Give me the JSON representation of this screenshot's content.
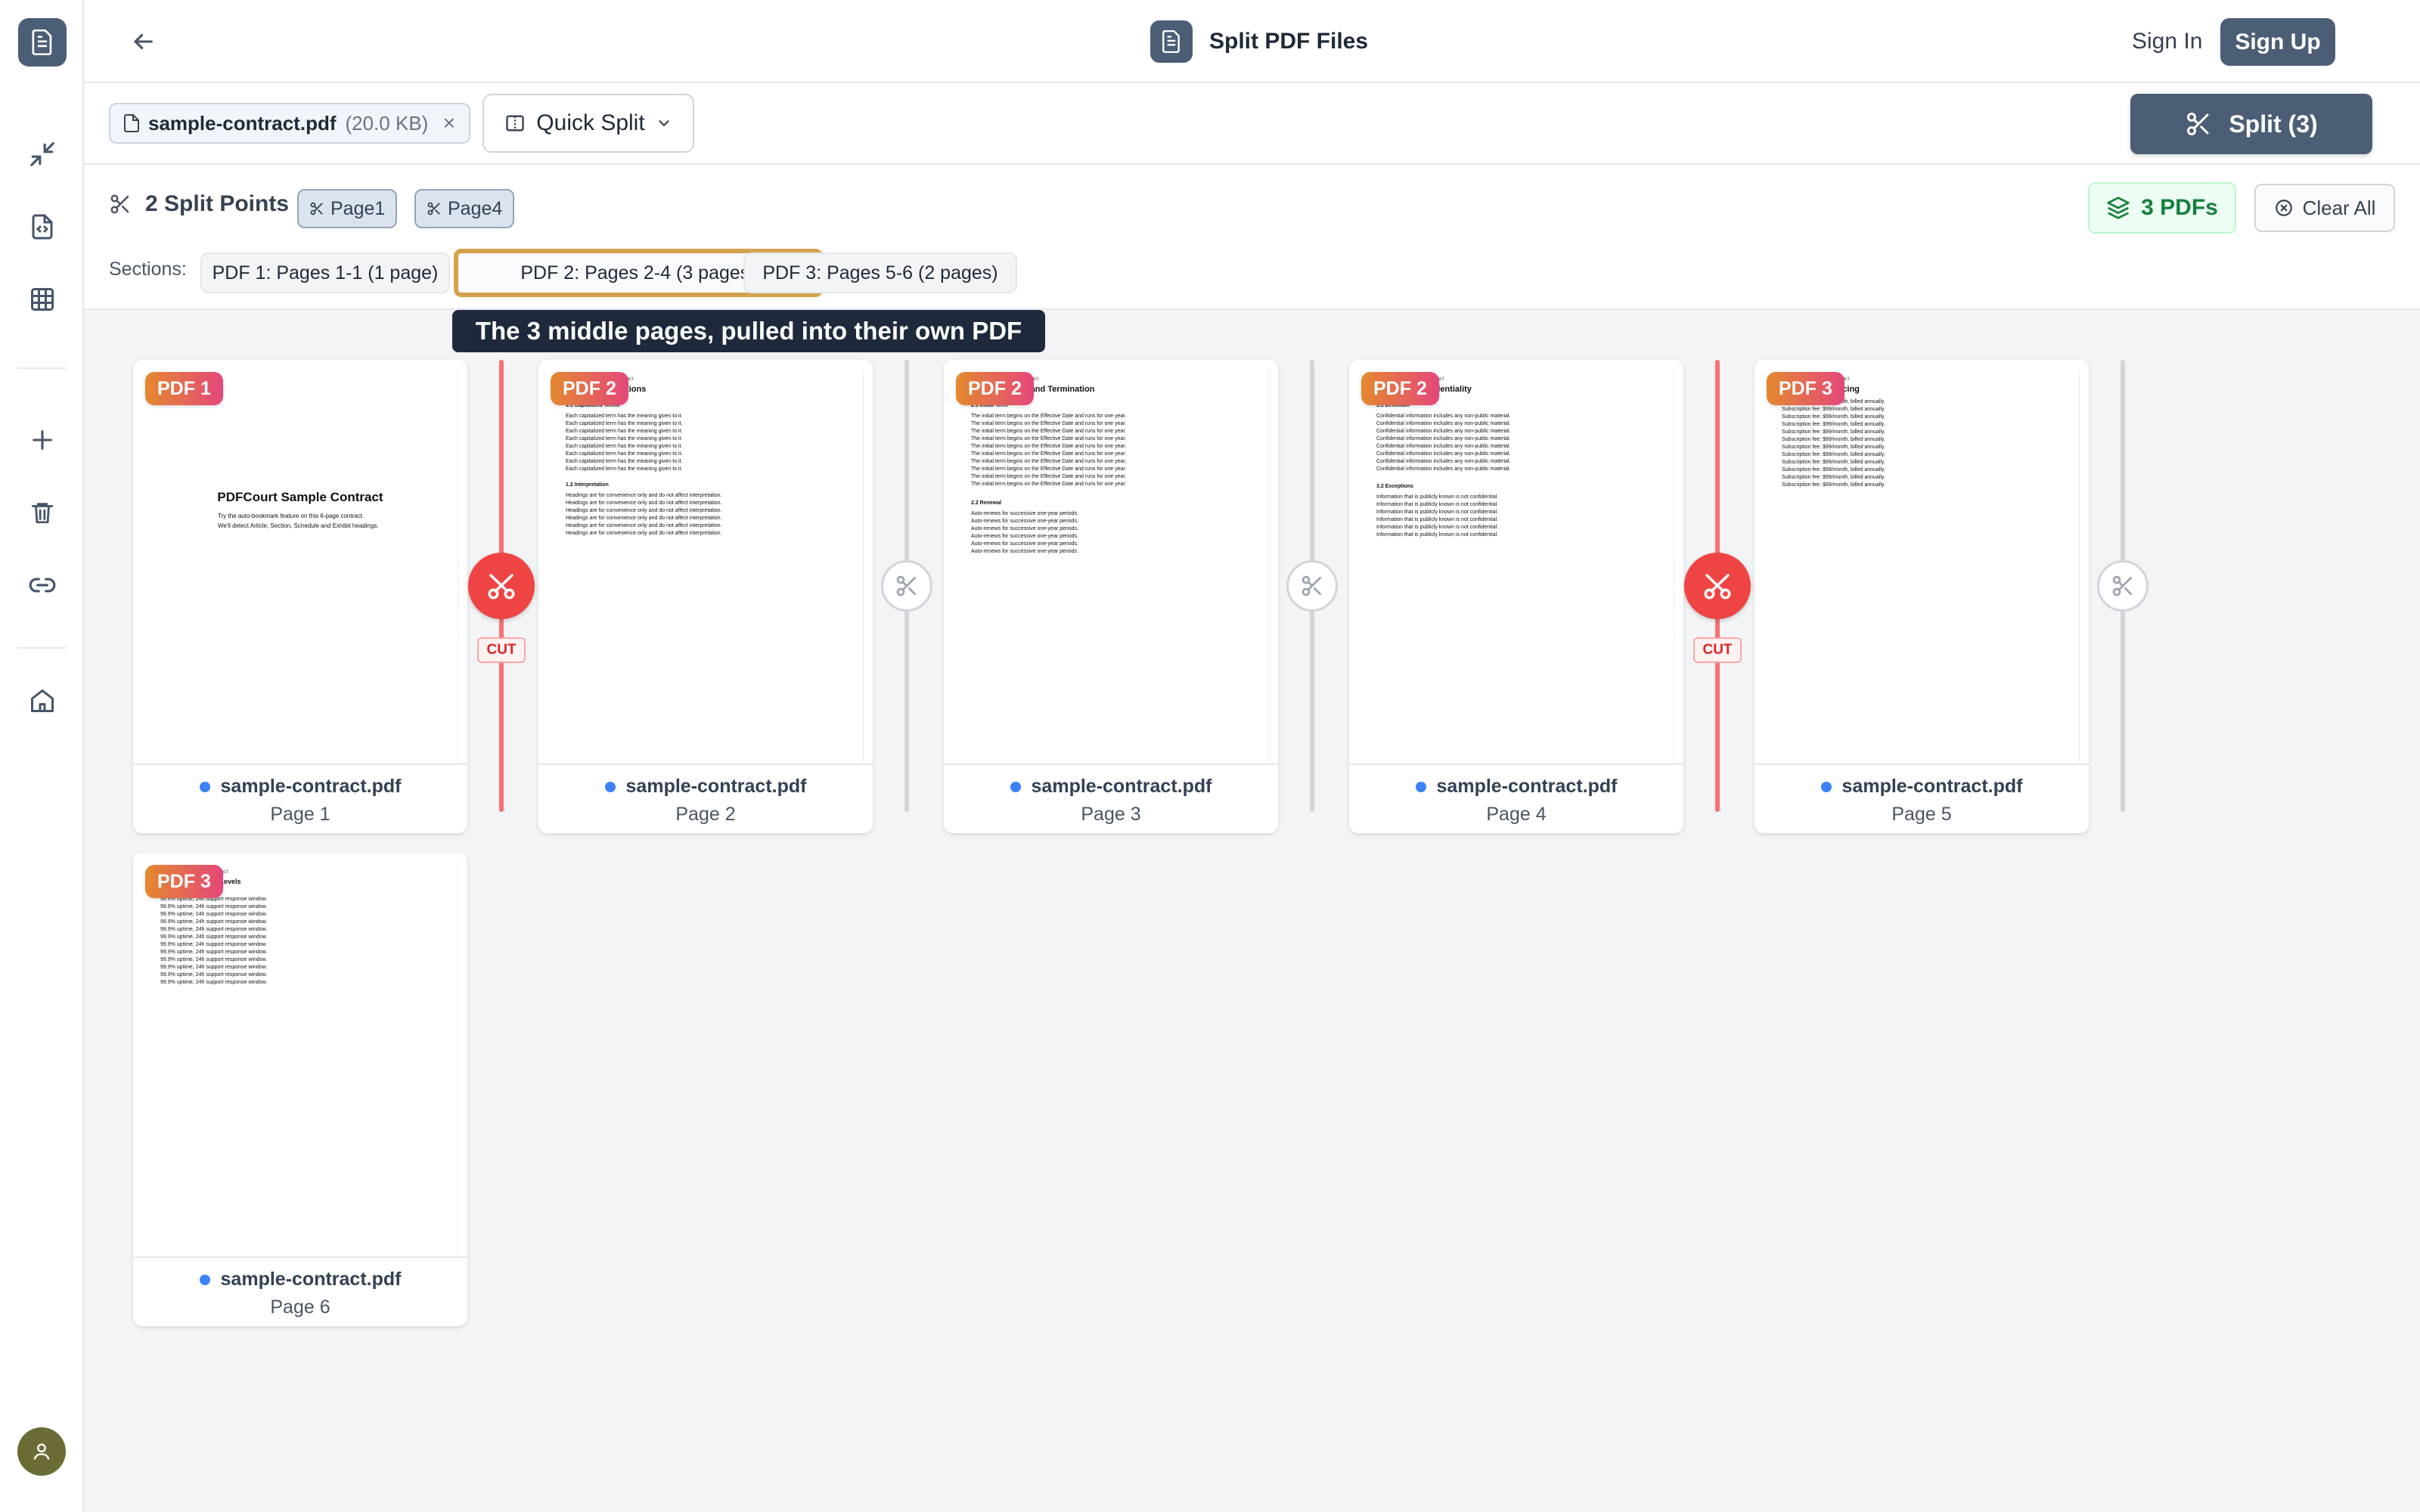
{
  "header": {
    "title": "Split PDF Files",
    "sign_in": "Sign In",
    "sign_up": "Sign Up"
  },
  "toolbar": {
    "file_name": "sample-contract.pdf",
    "file_size": "(20.0 KB)",
    "remove": "×",
    "mode": "Quick Split",
    "split_button": "Split (3)"
  },
  "split_info": {
    "label": "2 Split Points",
    "points": [
      "Page1",
      "Page4"
    ],
    "pdf_count": "3 PDFs",
    "clear_all": "Clear All"
  },
  "sections": {
    "label": "Sections:",
    "items": [
      "PDF 1: Pages 1-1 (1 page)",
      "PDF 2: Pages 2-4 (3 pages)",
      "PDF 3: Pages 5-6 (2 pages)"
    ],
    "active": 1
  },
  "tooltip": "The 3 middle pages, pulled into their own PDF",
  "cut_label": "CUT",
  "pages": [
    {
      "badge": "PDF 1",
      "file": "sample-contract.pdf",
      "page": "Page 1"
    },
    {
      "badge": "PDF 2",
      "file": "sample-contract.pdf",
      "page": "Page 2"
    },
    {
      "badge": "PDF 2",
      "file": "sample-contract.pdf",
      "page": "Page 3"
    },
    {
      "badge": "PDF 2",
      "file": "sample-contract.pdf",
      "page": "Page 4"
    },
    {
      "badge": "PDF 3",
      "file": "sample-contract.pdf",
      "page": "Page 5"
    },
    {
      "badge": "PDF 3",
      "file": "sample-contract.pdf",
      "page": "Page 6"
    }
  ],
  "thumbnails": {
    "p1": {
      "title": "PDFCourt Sample Contract",
      "line1": "Try the auto-bookmark feature on this 6-page contract.",
      "line2": "We'll detect Article, Section, Schedule and Exhibit headings."
    },
    "hdr": "PDFCourt Sample · Contract",
    "p2": {
      "title": "Article 1. Definitions",
      "s1": "1.1  Capitalized Terms",
      "l1": "Each capitalized term has the meaning given to it.",
      "s2": "1.2  Interpretation",
      "l2": "Headings are for convenience only and do not affect interpretation."
    },
    "p3": {
      "title": "Article 2. Term and Termination",
      "s1": "2.1  Initial Term",
      "l1": "The initial term begins on the Effective Date and runs for one year.",
      "s2": "2.2  Renewal",
      "l2": "Auto-renews for successive one-year periods."
    },
    "p4": {
      "title": "Article 3. Confidentiality",
      "s1": "3.1  Definition",
      "l1": "Confidential information includes any non-public material.",
      "s2": "3.2  Exceptions",
      "l2": "Information that is publicly known is not confidential."
    },
    "p5": {
      "title": "Schedule A. Pricing",
      "l1": "Subscription fee: $99/month, billed annually."
    },
    "p6": {
      "title": "Exhibit B. Service Levels",
      "l1": "99.9% uptime, 24h support response window."
    }
  }
}
